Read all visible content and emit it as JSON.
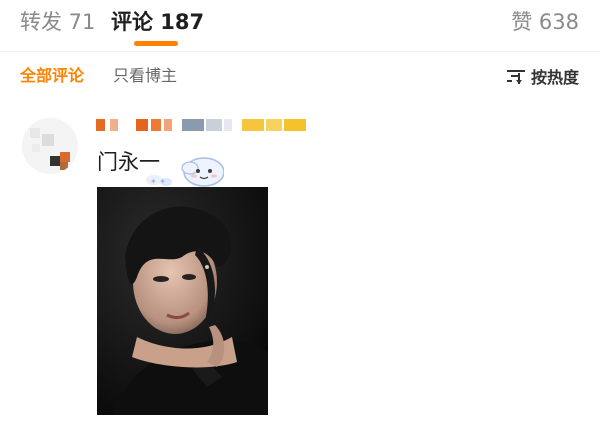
{
  "tabs": {
    "reposts": "转发 71",
    "comments": "评论 187",
    "likes": "赞 638"
  },
  "filters": {
    "all_comments": "全部评论",
    "only_op": "只看博主",
    "sort_label": "按热度"
  },
  "comment": {
    "text": "门永一"
  },
  "colors": {
    "accent": "#ff8200",
    "text_primary": "#1f1f1f",
    "text_secondary": "#8a8a8a"
  },
  "icons": {
    "sort": "sort-lines-icon",
    "sticker": "cloud-emoji-sticker-icon"
  }
}
